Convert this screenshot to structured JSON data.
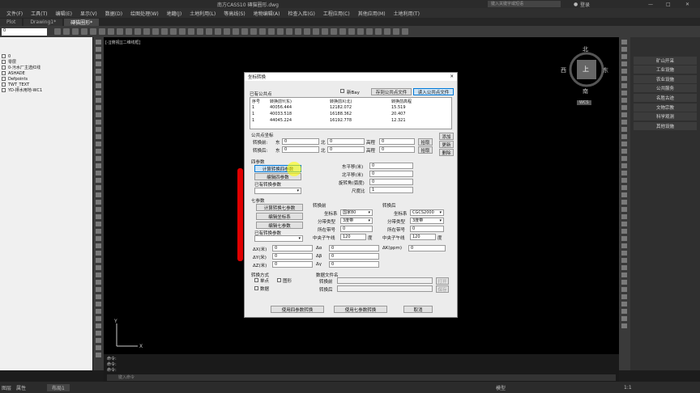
{
  "window": {
    "title": "南方CASS10  磚猫圈形.dwg",
    "search_placeholder": "键入关键字或短语",
    "login": "登录"
  },
  "menu": [
    "文件(F)",
    "工具(T)",
    "编辑(E)",
    "显示(V)",
    "数据(D)",
    "绘图处理(W)",
    "地籍(J)",
    "土地利用(L)",
    "等高线(S)",
    "地物编辑(A)",
    "检查入库(G)",
    "工程应用(C)",
    "其他应用(M)",
    "土地利用(T)"
  ],
  "tabs": [
    {
      "label": "Plot"
    },
    {
      "label": "Drawing1*"
    },
    {
      "label": "磚猫圈形*"
    }
  ],
  "layer_combo": "0",
  "layers": [
    "0",
    "零层",
    "0-污水厂主选红线",
    "ASHADE",
    "Defpoints",
    "TWT_TEXT",
    "YD-排水用地-WC1"
  ],
  "canvas_label": "[-][俯视][二维线框]",
  "compass": {
    "n": "北",
    "s": "南",
    "e": "东",
    "w": "西",
    "top": "上",
    "wcs": "WCS"
  },
  "right_panel": [
    "矿山开采",
    "工业设施",
    "农业设施",
    "公共服务",
    "名胜古迹",
    "文物宗教",
    "科学观测",
    "其他设施"
  ],
  "command": {
    "line1": "命令:",
    "line2": "命令:",
    "line3": "命令:",
    "prompt": "键入命令"
  },
  "status": {
    "model": "模型",
    "layout": "布局1",
    "left1": "图层",
    "left2": "属性",
    "scale": "1:1"
  },
  "dialog": {
    "title": "坐标转换",
    "known_points": "已有公共点",
    "chk_label": "新Bay",
    "save_btn": "存到公共点文件",
    "load_btn": "读入公共点文件",
    "headers": [
      "序号",
      "转换前Y(东)",
      "转换前X(北)",
      "转换前高程"
    ],
    "rows": [
      [
        "1",
        "40056.444",
        "12182.072",
        "15.519"
      ],
      [
        "1",
        "40033.518",
        "16188.362",
        "20.407"
      ],
      [
        "1",
        "44045.224",
        "16192.778",
        "12.321"
      ]
    ],
    "common_coord": "公共点坐标",
    "before": "转换前:",
    "after": "转换后:",
    "east": "东",
    "north": "北",
    "elev": "高程",
    "zero": "0",
    "pick": "拾取",
    "add": "添加",
    "update": "更新",
    "delete": "删除",
    "four_param": "四参数",
    "calc_four": "计算转换四参数",
    "edit_four": "编辑四参数",
    "has_four": "已有转换参数",
    "east_shift": "东平移(米)",
    "north_shift": "北平移(米)",
    "rotation": "旋转角(弧度)",
    "scale": "尺度比",
    "scale_val": "1",
    "seven_param": "七参数",
    "calc_seven": "计算转换七参数",
    "edit_sys": "编辑坐标系",
    "edit_seven": "编辑七参数",
    "has_seven": "已有转换参数",
    "before_t": "转换前",
    "after_t": "转换后",
    "coord_sys": "坐标系",
    "sys_before": "国家80",
    "sys_after": "CGCS2000",
    "zone_type": "分带类型",
    "zone_val": "3度带",
    "zone_no": "所在带号",
    "cm": "中央子午线",
    "cm_val": "120",
    "deg": "度",
    "dx": "ΔX(米)",
    "dy": "ΔY(米)",
    "dz": "ΔZ(米)",
    "da": "Δα",
    "db": "Δβ",
    "dg": "Δγ",
    "dk": "ΔK(ppm)",
    "method": "转换方式",
    "single": "单点",
    "graphic": "图形",
    "data": "数据",
    "data_file": "数据文件名",
    "file_before": "转换前",
    "file_after": "转换后",
    "open": "打开",
    "save": "保存",
    "use_four": "使用四参数转换",
    "use_seven": "使用七参数转换",
    "cancel": "取消"
  }
}
